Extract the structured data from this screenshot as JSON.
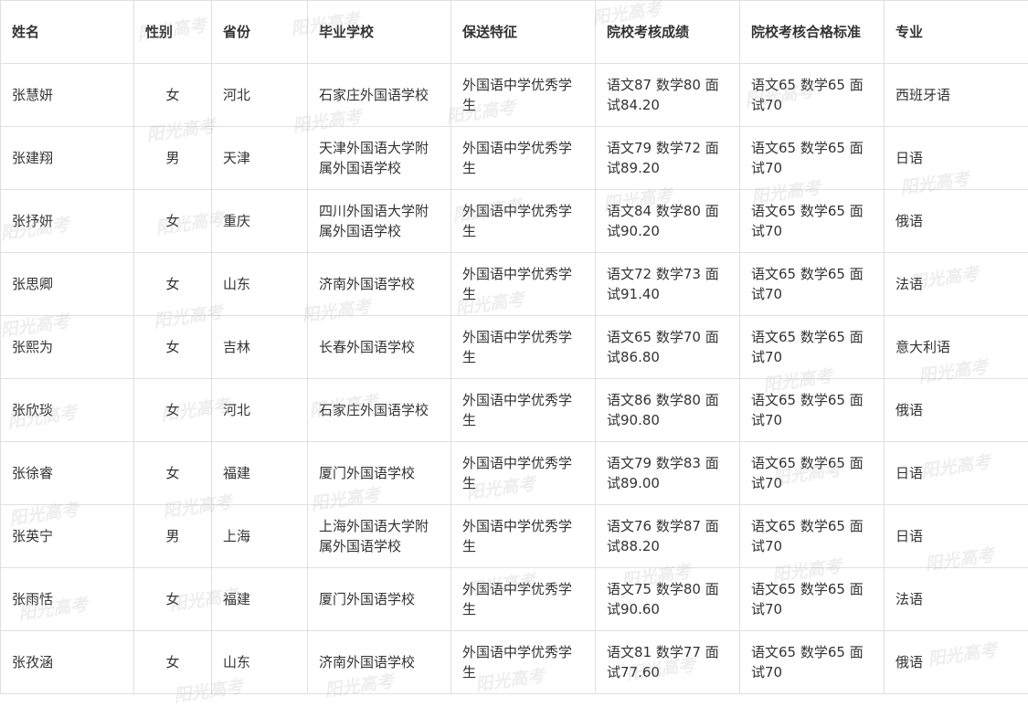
{
  "headers": [
    "姓名",
    "性别",
    "省份",
    "毕业学校",
    "保送特征",
    "院校考核成绩",
    "院校考核合格标准",
    "专业"
  ],
  "rows": [
    {
      "name": "张慧妍",
      "gender": "女",
      "province": "河北",
      "school": "石家庄外国语学校",
      "feature": "外国语中学优秀学生",
      "score": "语文87 数学80 面试84.20",
      "standard": "语文65 数学65 面试70",
      "major": "西班牙语"
    },
    {
      "name": "张建翔",
      "gender": "男",
      "province": "天津",
      "school": "天津外国语大学附属外国语学校",
      "feature": "外国语中学优秀学生",
      "score": "语文79 数学72 面试89.20",
      "standard": "语文65 数学65 面试70",
      "major": "日语"
    },
    {
      "name": "张抒妍",
      "gender": "女",
      "province": "重庆",
      "school": "四川外国语大学附属外国语学校",
      "feature": "外国语中学优秀学生",
      "score": "语文84 数学80 面试90.20",
      "standard": "语文65 数学65 面试70",
      "major": "俄语"
    },
    {
      "name": "张思卿",
      "gender": "女",
      "province": "山东",
      "school": "济南外国语学校",
      "feature": "外国语中学优秀学生",
      "score": "语文72 数学73 面试91.40",
      "standard": "语文65 数学65 面试70",
      "major": "法语"
    },
    {
      "name": "张熙为",
      "gender": "女",
      "province": "吉林",
      "school": "长春外国语学校",
      "feature": "外国语中学优秀学生",
      "score": "语文65 数学70 面试86.80",
      "standard": "语文65 数学65 面试70",
      "major": "意大利语"
    },
    {
      "name": "张欣琰",
      "gender": "女",
      "province": "河北",
      "school": "石家庄外国语学校",
      "feature": "外国语中学优秀学生",
      "score": "语文86 数学80 面试90.80",
      "standard": "语文65 数学65 面试70",
      "major": "俄语"
    },
    {
      "name": "张徐睿",
      "gender": "女",
      "province": "福建",
      "school": "厦门外国语学校",
      "feature": "外国语中学优秀学生",
      "score": "语文79 数学83 面试89.00",
      "standard": "语文65 数学65 面试70",
      "major": "日语"
    },
    {
      "name": "张英宁",
      "gender": "男",
      "province": "上海",
      "school": "上海外国语大学附属外国语学校",
      "feature": "外国语中学优秀学生",
      "score": "语文76 数学87 面试88.20",
      "standard": "语文65 数学65 面试70",
      "major": "日语"
    },
    {
      "name": "张雨恬",
      "gender": "女",
      "province": "福建",
      "school": "厦门外国语学校",
      "feature": "外国语中学优秀学生",
      "score": "语文75 数学80 面试90.60",
      "standard": "语文65 数学65 面试70",
      "major": "法语"
    },
    {
      "name": "张孜涵",
      "gender": "女",
      "province": "山东",
      "school": "济南外国语学校",
      "feature": "外国语中学优秀学生",
      "score": "语文81 数学77 面试77.60",
      "standard": "语文65 数学65 面试70",
      "major": "俄语"
    }
  ],
  "watermark": "阳光高考"
}
